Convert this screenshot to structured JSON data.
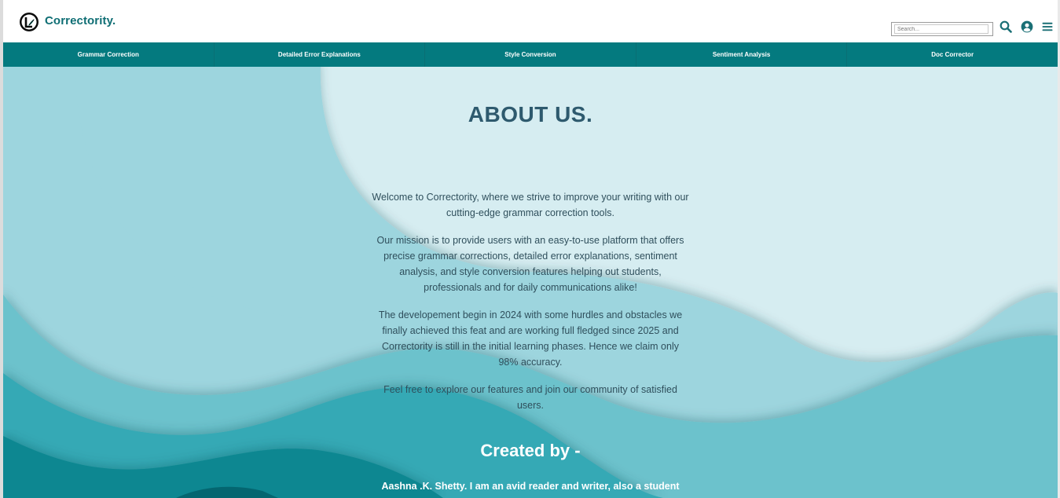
{
  "brand": {
    "name": "Correctority."
  },
  "search": {
    "placeholder": "Search..."
  },
  "nav": {
    "items": [
      {
        "label": "Grammar Correction"
      },
      {
        "label": "Detailed Error Explanations"
      },
      {
        "label": "Style Conversion"
      },
      {
        "label": "Sentiment Analysis"
      },
      {
        "label": "Doc Corrector"
      }
    ]
  },
  "about": {
    "title": "ABOUT US.",
    "paragraphs": [
      "Welcome to Correctority, where we strive to improve your writing with our cutting-edge grammar correction tools.",
      "Our mission is to provide users with an easy-to-use platform that offers precise grammar corrections, detailed error explanations, sentiment analysis, and style conversion features helping out students, professionals and for daily communications alike!",
      "The developement begin in 2024 with some hurdles and obstacles we finally achieved this feat and are working full fledged since 2025 and Correctority is still in the initial learning phases. Hence we claim only 98% accuracy.",
      "Feel free to explore our features and join our community of satisfied users."
    ],
    "created_heading": "Created by -",
    "creator_text": "Aashna .K. Shetty. I am an avid reader and writer, also a student"
  },
  "icons": {
    "logo": "logo-icon",
    "search": "search-icon",
    "user": "user-circle-icon",
    "menu": "hamburger-menu-icon"
  },
  "colors": {
    "brand": "#0f6e74",
    "nav_bg": "#047a7f",
    "title": "#2e5a6e",
    "hero_light": "#d6edf1",
    "wave_1": "#9dd5de",
    "wave_2": "#6cc2cc",
    "wave_3": "#35a9b5",
    "wave_4": "#0b8791"
  }
}
